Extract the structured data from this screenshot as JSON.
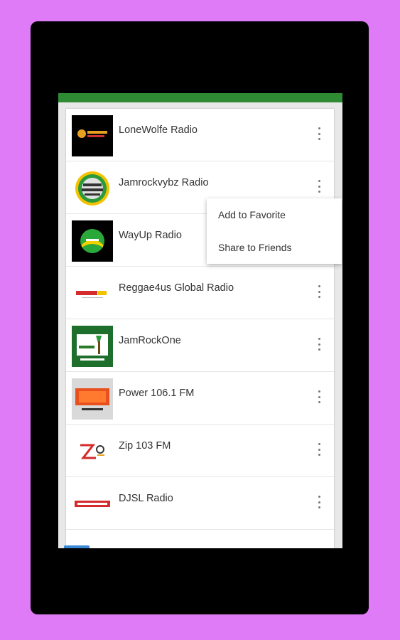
{
  "stations": [
    {
      "name": "LoneWolfe Radio",
      "logo_bg": "#000000"
    },
    {
      "name": "Jamrockvybz Radio",
      "logo_bg": "#ffffff"
    },
    {
      "name": "WayUp Radio",
      "logo_bg": "#000000"
    },
    {
      "name": "Reggae4us Global Radio",
      "logo_bg": "#ffffff"
    },
    {
      "name": "JamRockOne",
      "logo_bg": "#1f6f2c"
    },
    {
      "name": "Power 106.1 FM",
      "logo_bg": "#d9d9d9"
    },
    {
      "name": "Zip 103 FM",
      "logo_bg": "#ffffff"
    },
    {
      "name": "DJSL Radio",
      "logo_bg": "#ffffff"
    }
  ],
  "context_menu": {
    "add_favorite": "Add to Favorite",
    "share": "Share to Friends"
  },
  "colors": {
    "background": "#df7bf6",
    "toolbar": "#2e8b34",
    "accent": "#3b88d6"
  }
}
